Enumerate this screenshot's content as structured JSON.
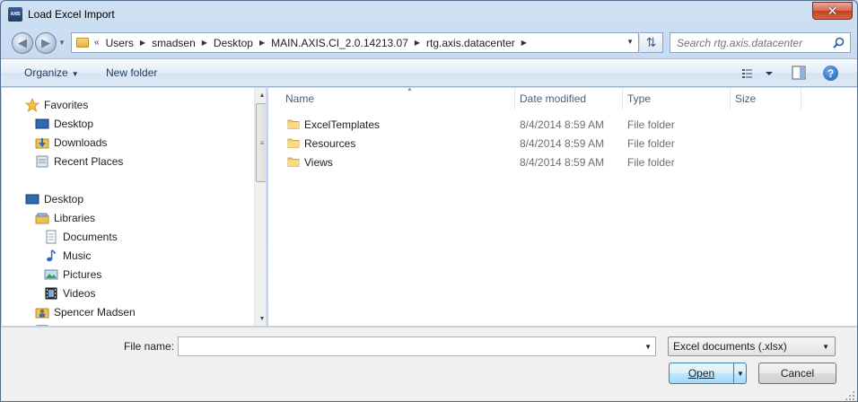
{
  "window": {
    "title": "Load Excel Import",
    "app_icon_text": "AXIS",
    "close_glyph": "✕"
  },
  "address_bar": {
    "overflow_glyph": "«",
    "crumbs": [
      "Users",
      "smadsen",
      "Desktop",
      "MAIN.AXIS.CI_2.0.14213.07",
      "rtg.axis.datacenter"
    ]
  },
  "search": {
    "placeholder": "Search rtg.axis.datacenter"
  },
  "toolbar": {
    "organize_label": "Organize",
    "new_folder_label": "New folder",
    "help_glyph": "?"
  },
  "nav_tree": {
    "favorites": {
      "label": "Favorites",
      "items": [
        "Desktop",
        "Downloads",
        "Recent Places"
      ]
    },
    "desktop_label": "Desktop",
    "libraries": {
      "label": "Libraries",
      "items": [
        "Documents",
        "Music",
        "Pictures",
        "Videos"
      ]
    },
    "user_label": "Spencer Madsen"
  },
  "file_list": {
    "columns": {
      "name": "Name",
      "date_modified": "Date modified",
      "type": "Type",
      "size": "Size"
    },
    "rows": [
      {
        "name": "ExcelTemplates",
        "date": "8/4/2014 8:59 AM",
        "type": "File folder",
        "size": ""
      },
      {
        "name": "Resources",
        "date": "8/4/2014 8:59 AM",
        "type": "File folder",
        "size": ""
      },
      {
        "name": "Views",
        "date": "8/4/2014 8:59 AM",
        "type": "File folder",
        "size": ""
      }
    ]
  },
  "bottom": {
    "file_name_label": "File name:",
    "file_name_value": "",
    "filter_value": "Excel documents (.xlsx)",
    "open_label": "Open",
    "cancel_label": "Cancel"
  }
}
